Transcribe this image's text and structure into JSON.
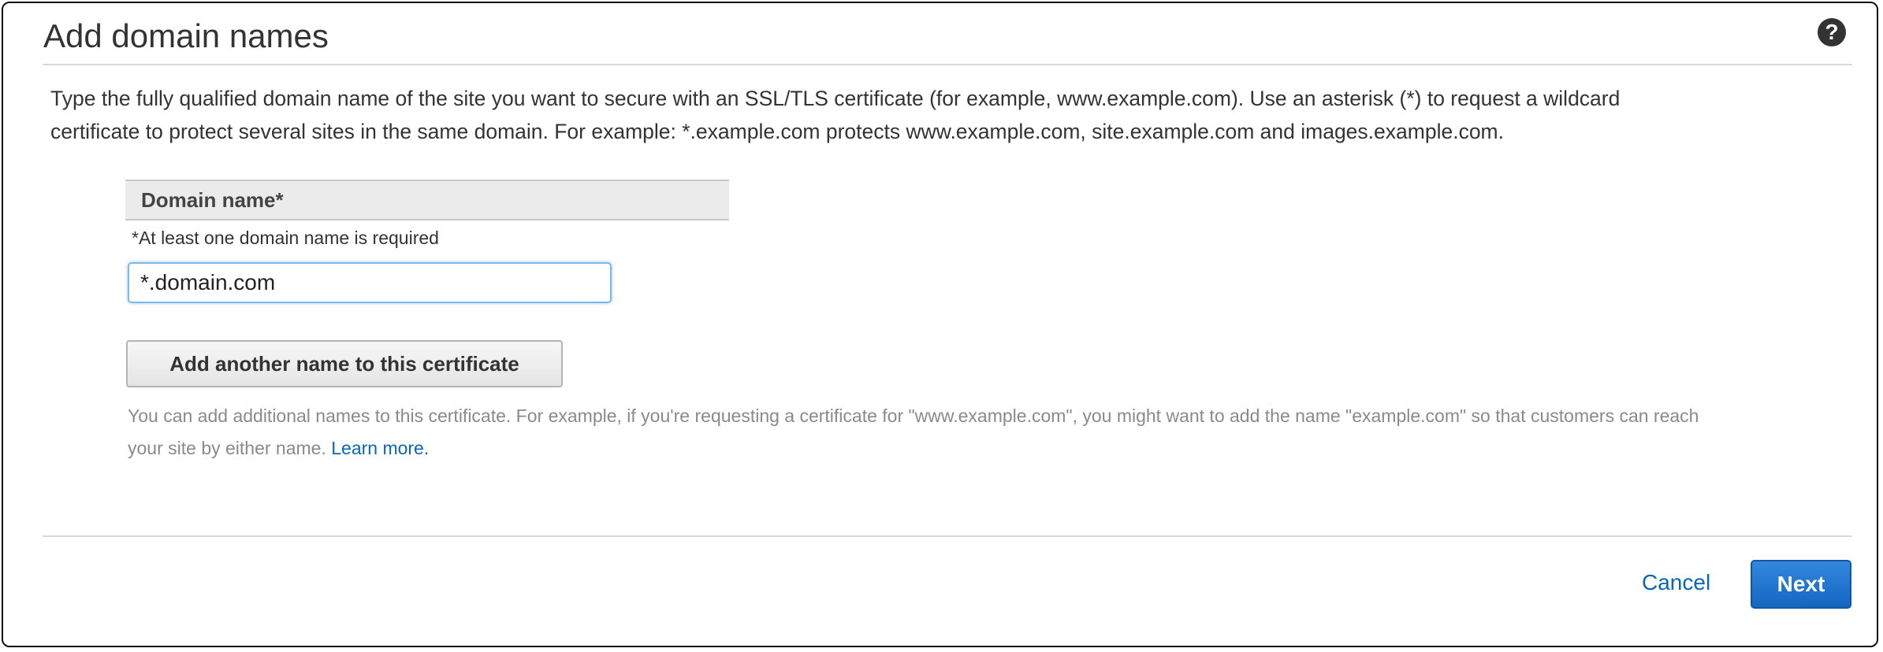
{
  "header": {
    "title": "Add domain names",
    "help_icon": "question-circle-icon",
    "help_glyph": "?"
  },
  "description": {
    "line1": "Type the fully qualified domain name of the site you want to secure with an SSL/TLS certificate (for example, www.example.com). Use an asterisk (*) to request a wildcard",
    "line2": "certificate to protect several sites in the same domain. For example: *.example.com protects www.example.com, site.example.com and images.example.com."
  },
  "domain_section": {
    "column_header": "Domain name*",
    "required_note": "*At least one domain name is required",
    "input_value": "*.domain.com"
  },
  "add_button_label": "Add another name to this certificate",
  "help_text": {
    "line1": "You can add additional names to this certificate. For example, if you're requesting a certificate for \"www.example.com\", you might want to add the name \"example.com\" so that customers can reach",
    "line2_prefix": "your site by either name.",
    "learn_more": "Learn more."
  },
  "footer": {
    "cancel_label": "Cancel",
    "next_label": "Next"
  },
  "colors": {
    "accent": "#1466c2",
    "link": "#0a66b8",
    "divider": "#d9d9d9",
    "muted_text": "#8a8a8a"
  }
}
